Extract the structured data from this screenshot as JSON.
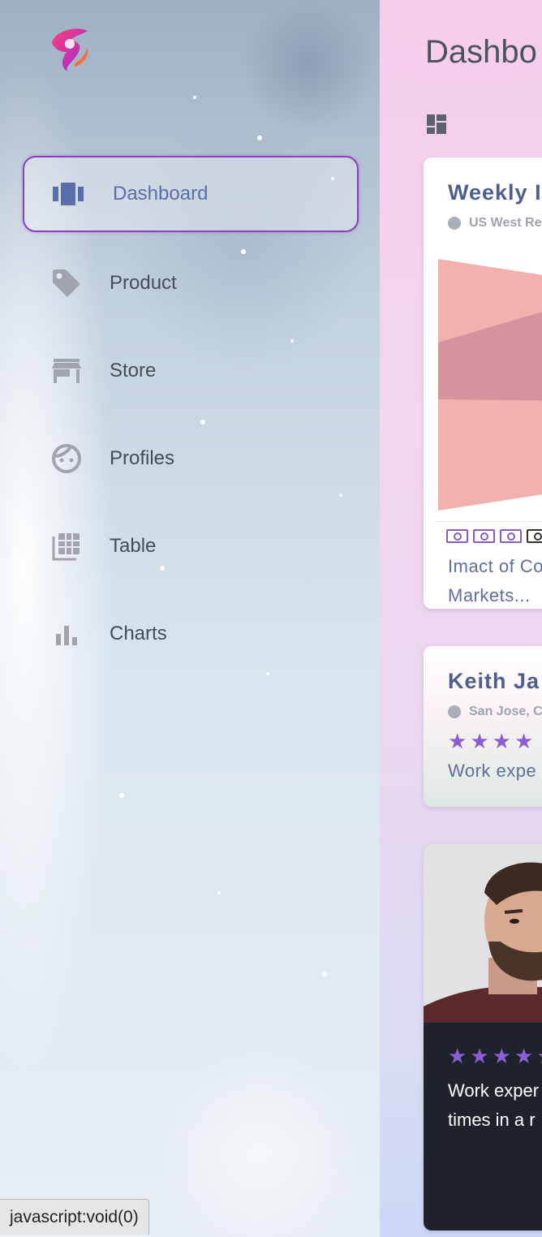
{
  "sidebar": {
    "items": [
      {
        "label": "Dashboard",
        "icon": "dashboard-icon",
        "active": true
      },
      {
        "label": "Product",
        "icon": "tag-icon",
        "active": false
      },
      {
        "label": "Store",
        "icon": "store-icon",
        "active": false
      },
      {
        "label": "Profiles",
        "icon": "face-icon",
        "active": false
      },
      {
        "label": "Table",
        "icon": "table-icon",
        "active": false
      },
      {
        "label": "Charts",
        "icon": "bar-chart-icon",
        "active": false
      }
    ],
    "accent_color": "#8e3fbf"
  },
  "main": {
    "title": "Dashbo",
    "cards": {
      "weekly": {
        "title": "Weekly I",
        "subtitle": "US West Re",
        "text_line1": "Imact of Co",
        "text_line2": "Markets..."
      },
      "profile": {
        "title": "Keith Ja",
        "subtitle": "San Jose, C",
        "rating": 4,
        "text": "Work expe"
      },
      "photo": {
        "rating": 5,
        "text_line1": "Work exper",
        "text_line2": "times in a r"
      }
    }
  },
  "status_bar": {
    "text": "javascript:void(0)"
  }
}
